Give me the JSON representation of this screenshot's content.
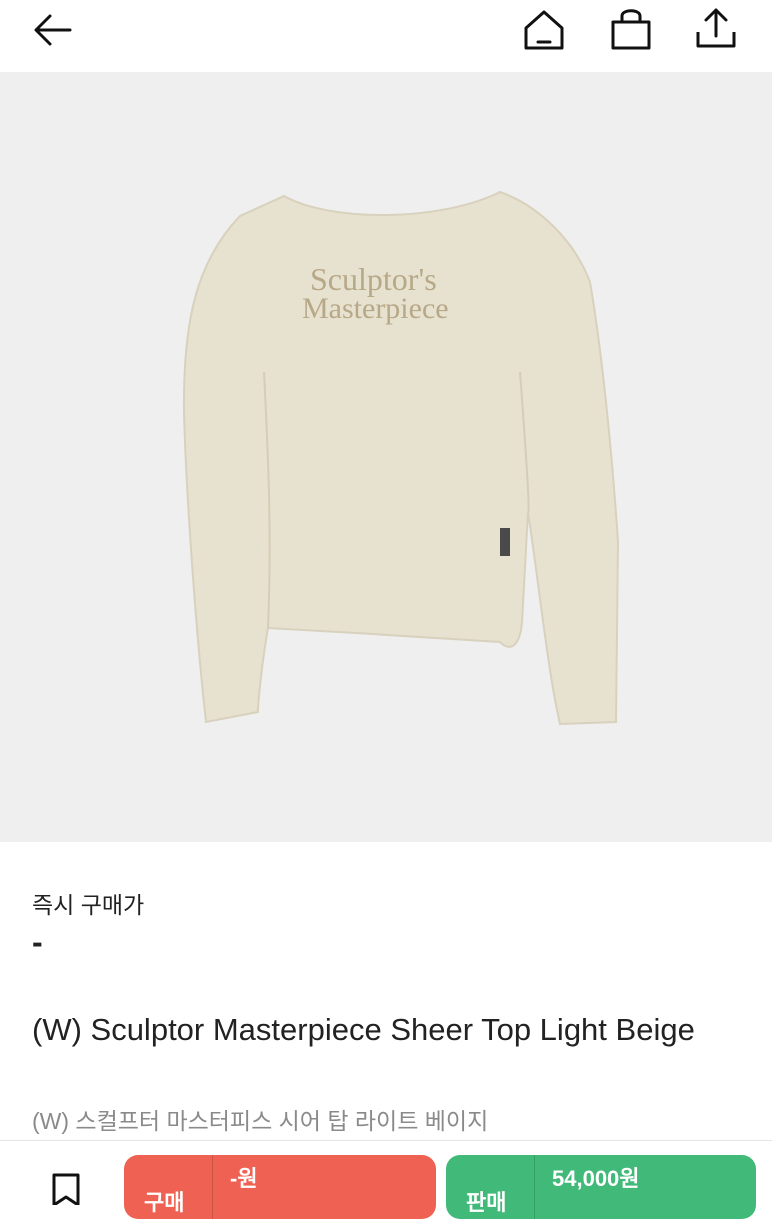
{
  "toolbar": {
    "back_icon": "arrow-left-icon",
    "home_icon": "home-icon",
    "bag_icon": "shopping-bag-icon",
    "share_icon": "share-icon"
  },
  "product": {
    "image_print_line1": "Sculptor's",
    "image_print_line2": "Masterpiece",
    "instant_price_label": "즉시 구매가",
    "instant_price_value": "-",
    "title": "(W) Sculptor Masterpiece Sheer Top Light Beige",
    "subtitle": "(W) 스컬프터 마스터피스 시어 탑 라이트 베이지"
  },
  "actions": {
    "wish_icon": "bookmark-icon",
    "buy_label": "구매",
    "buy_price": "-원",
    "sell_label": "판매",
    "sell_price": "54,000원"
  },
  "colors": {
    "buy": "#ef6253",
    "sell": "#41b979",
    "image_bg": "#efefef",
    "garment": "#e7e1cf",
    "print": "#b7a888"
  }
}
